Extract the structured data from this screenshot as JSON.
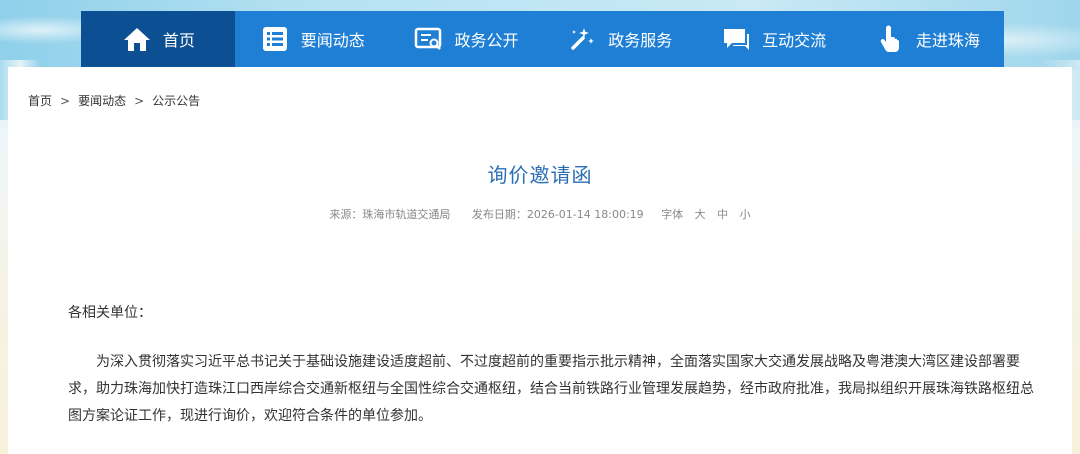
{
  "nav": {
    "items": [
      {
        "label": "首页",
        "icon": "home-icon",
        "active": true
      },
      {
        "label": "要闻动态",
        "icon": "list-icon"
      },
      {
        "label": "政务公开",
        "icon": "document-icon"
      },
      {
        "label": "政务服务",
        "icon": "tools-icon"
      },
      {
        "label": "互动交流",
        "icon": "chat-icon"
      },
      {
        "label": "走进珠海",
        "icon": "hand-pointer-icon"
      }
    ]
  },
  "breadcrumb": {
    "items": [
      "首页",
      "要闻动态",
      "公示公告"
    ],
    "separator": ">"
  },
  "article": {
    "title": "询价邀请函",
    "source": "来源：珠海市轨道交通局",
    "date": "发布日期：2026-01-14 18:00:19",
    "font_label": "字体",
    "font_large": "大",
    "font_medium": "中",
    "font_small": "小",
    "salutation": "各相关单位：",
    "paragraph": "为深入贯彻落实习近平总书记关于基础设施建设适度超前、不过度超前的重要指示批示精神，全面落实国家大交通发展战略及粤港澳大湾区建设部署要求，助力珠海加快打造珠江口西岸综合交通新枢纽与全国性综合交通枢纽，结合当前铁路行业管理发展趋势，经市政府批准，我局拟组织开展珠海铁路枢纽总图方案论证工作，现进行询价，欢迎符合条件的单位参加。"
  },
  "colors": {
    "nav_bg": "#1f7fd4",
    "nav_active": "#0d4f93",
    "title": "#2b6eb4"
  }
}
